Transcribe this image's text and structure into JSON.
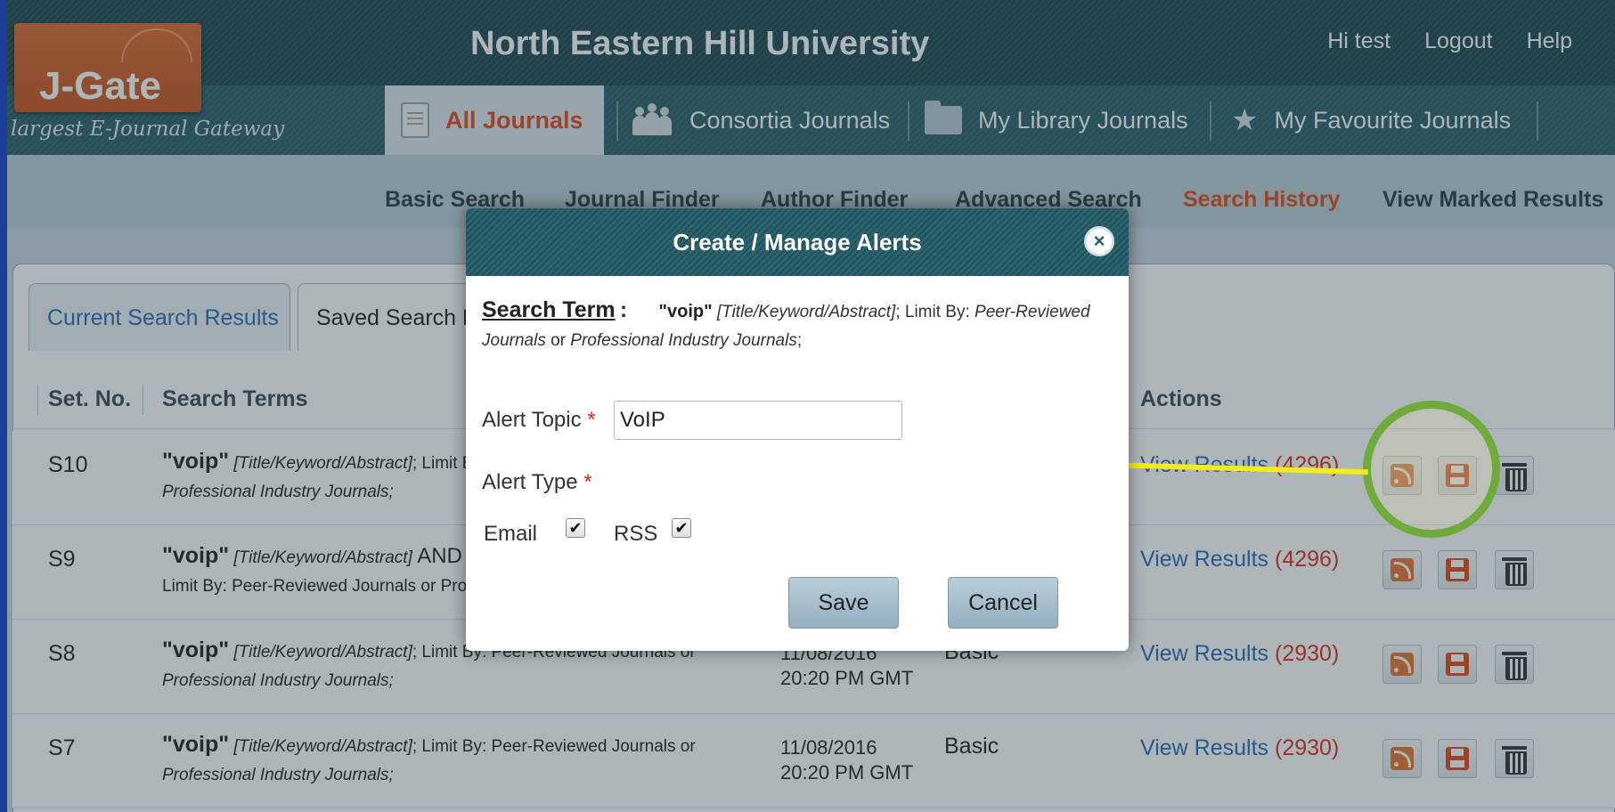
{
  "header": {
    "org_name": "North Eastern Hill University",
    "user_links": [
      "Hi test",
      "Logout",
      "Help"
    ],
    "logo_text": "J-Gate",
    "tagline": "largest E-Journal Gateway"
  },
  "journal_tabs": [
    {
      "label": "All Journals",
      "icon": "document-icon",
      "active": true
    },
    {
      "label": "Consortia Journals",
      "icon": "people-icon",
      "active": false
    },
    {
      "label": "My Library Journals",
      "icon": "folder-icon",
      "active": false
    },
    {
      "label": "My Favourite Journals",
      "icon": "star-icon",
      "active": false
    }
  ],
  "sub_nav": [
    {
      "label": "Basic Search",
      "active": false
    },
    {
      "label": "Journal Finder",
      "active": false
    },
    {
      "label": "Author Finder",
      "active": false
    },
    {
      "label": "Advanced Search",
      "active": false
    },
    {
      "label": "Search History",
      "active": true
    },
    {
      "label": "View Marked Results",
      "active": false
    }
  ],
  "result_tabs": [
    "Current Search Results",
    "Saved Search Results"
  ],
  "table": {
    "columns": [
      "Set. No.",
      "Search Terms",
      "Actions"
    ],
    "rows": [
      {
        "set_no": "S10",
        "term": "\"voip\"",
        "field": "[Title/Keyword/Abstract]",
        "rest": ";  Limit By: Peer-Reviewed Journals or",
        "line2": "Professional Industry Journals;",
        "date": "",
        "time": "",
        "type": "",
        "view": "View Results",
        "count": "(4296)"
      },
      {
        "set_no": "S9",
        "term": "\"voip\"",
        "field": "[Title/Keyword/Abstract]",
        "rest": " AND",
        "line2": "Limit By: Peer-Reviewed Journals or Pro",
        "date": "",
        "time": "",
        "type": "",
        "view": "View Results",
        "count": "(4296)"
      },
      {
        "set_no": "S8",
        "term": "\"voip\"",
        "field": "[Title/Keyword/Abstract]",
        "rest": ";  Limit By: Peer-Reviewed Journals or",
        "line2": "Professional Industry Journals;",
        "date": "11/08/2016",
        "time": "20:20 PM GMT",
        "type": "Basic",
        "view": "View Results",
        "count": "(2930)"
      },
      {
        "set_no": "S7",
        "term": "\"voip\"",
        "field": "[Title/Keyword/Abstract]",
        "rest": ";  Limit By: Peer-Reviewed Journals or",
        "line2": "Professional Industry Journals;",
        "date": "11/08/2016",
        "time": "20:20 PM GMT",
        "type": "Basic",
        "view": "View Results",
        "count": "(2930)"
      }
    ],
    "action_icons": [
      "rss-icon",
      "save-icon",
      "trash-icon"
    ]
  },
  "modal": {
    "title": "Create / Manage Alerts",
    "close_glyph": "×",
    "search_term_label": "Search Term",
    "search_term_colon": ":",
    "term": "\"voip\"",
    "field": "[Title/Keyword/Abstract]",
    "limit_by": "; Limit By:",
    "journal_a": "Peer-Reviewed Journals",
    "or": "or",
    "journal_b": "Professional Industry Journals",
    "semi": ";",
    "alert_topic_label": "Alert Topic",
    "alert_topic_value": "VoIP",
    "required_mark": "*",
    "alert_type_label": "Alert Type",
    "email_label": "Email",
    "email_checked": true,
    "rss_label": "RSS",
    "rss_checked": true,
    "check_glyph": "✔",
    "save_label": "Save",
    "cancel_label": "Cancel"
  },
  "colors": {
    "accent_orange": "#e24a1a",
    "link_blue": "#2b6ab6",
    "annotation_yellow": "#f2ec1c",
    "annotation_green": "#6fab3a"
  }
}
